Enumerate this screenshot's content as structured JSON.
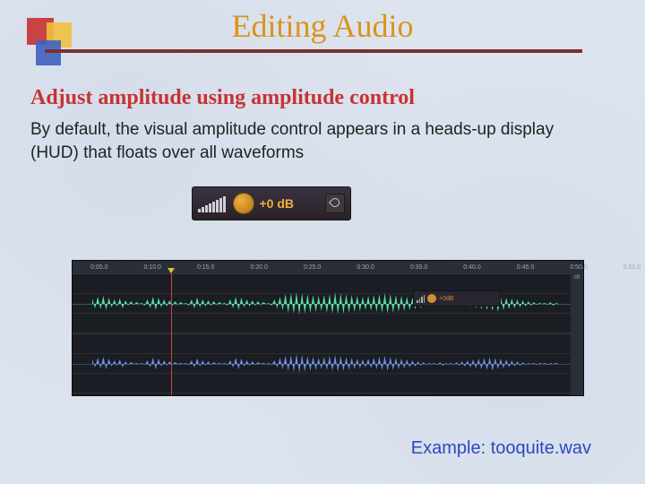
{
  "title": "Editing Audio",
  "subtitle": "Adjust amplitude using amplitude control",
  "body": "By default, the visual amplitude control appears in a heads-up display (HUD) that floats over all waveforms",
  "hud": {
    "db_label": "+0 dB"
  },
  "timeline_ticks": [
    "0:05.0",
    "0:10.0",
    "0:15.0",
    "0:20.0",
    "0:25.0",
    "0:30.0",
    "0:35.0",
    "0:40.0",
    "0:45.0",
    "0:50.0",
    "0:55.0"
  ],
  "db_label": "dB",
  "mini_hud_label": "+0dB",
  "example": "Example: tooquite.wav"
}
